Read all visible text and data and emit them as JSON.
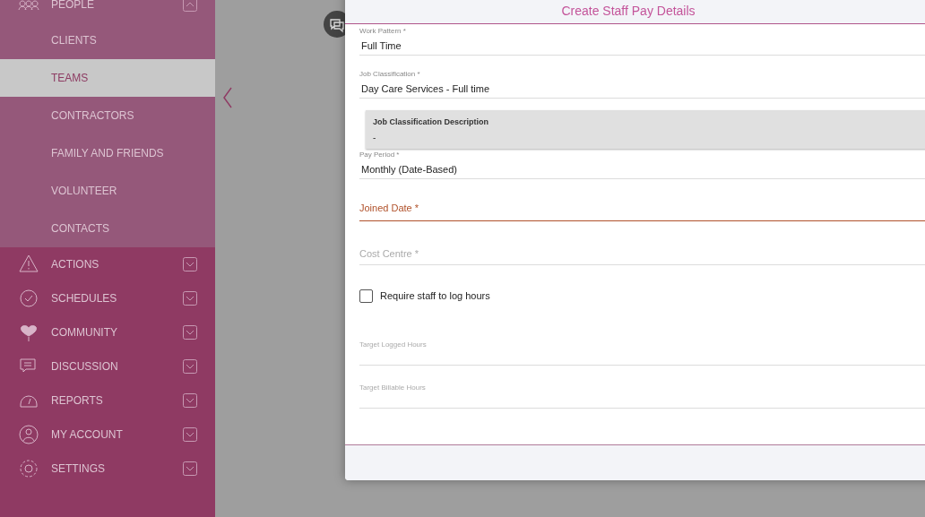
{
  "sidebar": {
    "items": [
      {
        "label": "PEOPLE",
        "expanded": true,
        "children": [
          {
            "label": "CLIENTS",
            "selected": false
          },
          {
            "label": "TEAMS",
            "selected": true
          },
          {
            "label": "CONTRACTORS",
            "selected": false
          },
          {
            "label": "FAMILY AND FRIENDS",
            "selected": false
          },
          {
            "label": "VOLUNTEER",
            "selected": false
          },
          {
            "label": "CONTACTS",
            "selected": false
          }
        ]
      },
      {
        "label": "ACTIONS",
        "expanded": false
      },
      {
        "label": "SCHEDULES",
        "expanded": false
      },
      {
        "label": "COMMUNITY",
        "expanded": false
      },
      {
        "label": "DISCUSSION",
        "expanded": false
      },
      {
        "label": "REPORTS",
        "expanded": false
      },
      {
        "label": "MY ACCOUNT",
        "expanded": false
      },
      {
        "label": "SETTINGS",
        "expanded": false
      }
    ]
  },
  "dialog": {
    "title": "Create Staff Pay Details",
    "fields": [
      {
        "kind": "select",
        "label": "Work Pattern *",
        "value": "Full Time"
      },
      {
        "kind": "select",
        "label": "Job Classification *",
        "value": "Day Care Services - Full time"
      },
      {
        "kind": "info",
        "label": "Job Classification Description",
        "value": "-"
      },
      {
        "kind": "select",
        "label": "Pay Period *",
        "value": "Monthly (Date-Based)"
      },
      {
        "kind": "date",
        "placeholder": "Joined Date *",
        "invalid": true
      },
      {
        "kind": "text",
        "placeholder": "Cost Centre *"
      },
      {
        "kind": "checkbox",
        "label": "Require staff to log hours",
        "checked": false
      },
      {
        "kind": "number",
        "label": "Target Logged Hours"
      },
      {
        "kind": "number",
        "label": "Target Billable Hours"
      }
    ]
  }
}
